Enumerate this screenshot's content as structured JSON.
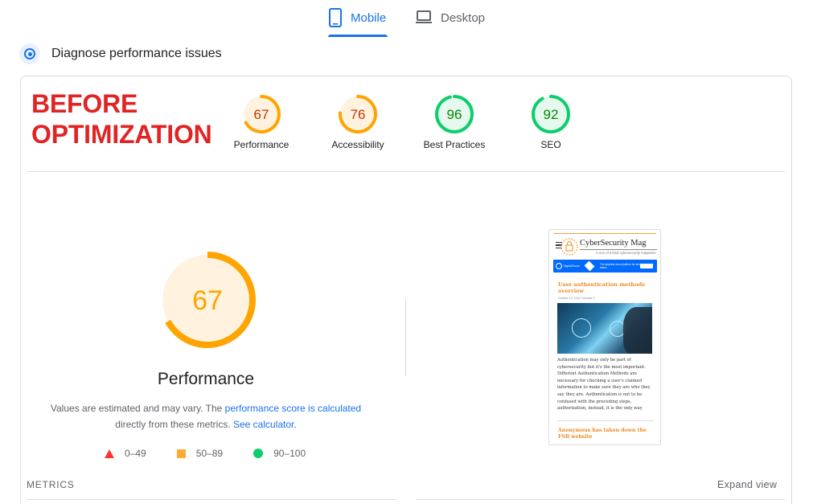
{
  "tabs": [
    {
      "label": "Mobile",
      "active": true,
      "icon": "smartphone-icon"
    },
    {
      "label": "Desktop",
      "active": false,
      "icon": "laptop-icon"
    }
  ],
  "diagnose": {
    "title": "Diagnose performance issues",
    "icon": "diagnose-icon"
  },
  "banner": {
    "line1": "BEFORE",
    "line2": "OPTIMIZATION",
    "color": "#e02424"
  },
  "scores": [
    {
      "label": "Performance",
      "value": "67",
      "color": "#ffa400",
      "text_color": "#c33300",
      "fill": "#fff3e0"
    },
    {
      "label": "Accessibility",
      "value": "76",
      "color": "#ffa400",
      "text_color": "#c33300",
      "fill": "#fff3e0"
    },
    {
      "label": "Best Practices",
      "value": "96",
      "color": "#0cce6b",
      "text_color": "#008800",
      "fill": "#e6f9ee"
    },
    {
      "label": "SEO",
      "value": "92",
      "color": "#0cce6b",
      "text_color": "#008800",
      "fill": "#e6f9ee"
    }
  ],
  "main": {
    "score": "67",
    "title": "Performance",
    "desc_prefix": "Values are estimated and may vary. The ",
    "desc_link1": "performance score is calculated",
    "desc_middle": "directly from these metrics. ",
    "desc_link2": "See calculator",
    "desc_suffix": "."
  },
  "legend": [
    {
      "range": "0–49",
      "shape": "triangle",
      "color": "#ff3333"
    },
    {
      "range": "50–89",
      "shape": "square",
      "color": "#ffaa33"
    },
    {
      "range": "90–100",
      "shape": "circle",
      "color": "#0cce6b"
    }
  ],
  "metrics_label": "METRICS",
  "expand_label": "Expand view",
  "screenshot": {
    "brand": "CyberSecurity Mag",
    "tagline": "A one of a kind cybersecurity magazine",
    "ad_brand": "DigitalOcean",
    "ad_text": "The simplest cloud platform for developers and teams",
    "headline": "User authentication methods overview",
    "meta": "October 10, 2022   Tutorials   0",
    "body": "Authentication may only be part of cybersecurity but it's the most important. Different Authentication Methods are necessary for checking a user's claimed information to make sure they are who they say they are. Authentication is not to be confused with the preceding steps, authorization, instead, it is the only way",
    "next_headline": "Anonymous has taken down the FSB website"
  }
}
